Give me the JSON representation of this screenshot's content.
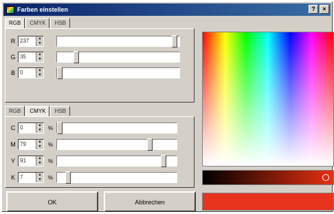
{
  "window": {
    "title": "Farben einstellen",
    "help_label": "?",
    "close_label": "×"
  },
  "rgb_tabs": [
    "RGB",
    "CMYK",
    "HSB"
  ],
  "cmyk_tabs": [
    "RGB",
    "CMYK",
    "HSB"
  ],
  "rgb": {
    "rows": [
      {
        "label": "R",
        "value": "237",
        "fraction": 0.98
      },
      {
        "label": "G",
        "value": "35",
        "fraction": 0.14
      },
      {
        "label": "B",
        "value": "0",
        "fraction": 0.0
      }
    ]
  },
  "cmyk": {
    "unit": "%",
    "rows": [
      {
        "label": "C",
        "value": "0",
        "fraction": 0.0
      },
      {
        "label": "M",
        "value": "79",
        "fraction": 0.79
      },
      {
        "label": "Y",
        "value": "91",
        "fraction": 0.91
      },
      {
        "label": "K",
        "value": "7",
        "fraction": 0.07
      }
    ]
  },
  "buttons": {
    "ok": "OK",
    "cancel": "Abbrechen"
  },
  "colors": {
    "accent": "#0a246a",
    "selected": "#e8341c"
  }
}
